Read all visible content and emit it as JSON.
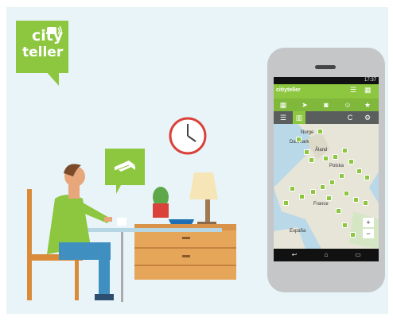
{
  "logo": {
    "line1": "city",
    "line2": "teller"
  },
  "app": {
    "status_time": "17:37",
    "title": "citiyteller",
    "toolbar_icons": [
      "grid-icon",
      "locate-arrow-icon",
      "camera-icon",
      "person-icon",
      "star-map-icon"
    ],
    "view_icons": [
      "list-icon",
      "map-icon",
      "refresh-icon",
      "settings-icon"
    ],
    "map_labels": [
      "Åland",
      "Norge",
      "Danmark",
      "Polska",
      "France",
      "España"
    ],
    "zoom_in": "+",
    "zoom_out": "−"
  },
  "colors": {
    "brand": "#8dc63f",
    "bg": "#e9f4f8"
  }
}
